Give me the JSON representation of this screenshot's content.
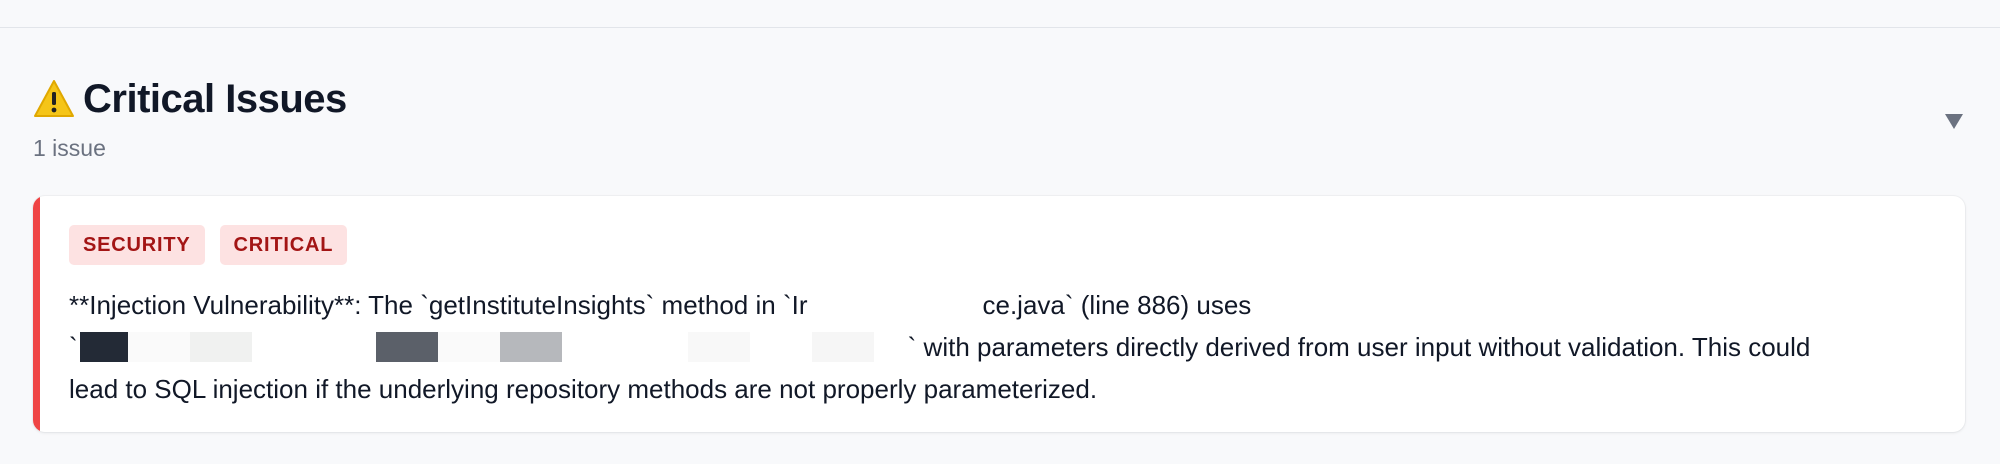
{
  "section": {
    "title": "Critical Issues",
    "issue_count": "1 issue",
    "icon": "warning-icon",
    "toggle_icon": "collapse-triangle-icon"
  },
  "issue": {
    "badges": [
      "SECURITY",
      "CRITICAL"
    ],
    "line1_a": "**Injection Vulnerability**: The `getInstituteInsights` method in `Ir",
    "line1_b": "ce.java` (line 886) uses",
    "line2_open": "`",
    "line2_rest": "` with parameters directly derived from user input without validation. This could",
    "line3": "lead to SQL injection if the underlying repository methods are not properly parameterized.",
    "accent_color": "#ef4444"
  }
}
